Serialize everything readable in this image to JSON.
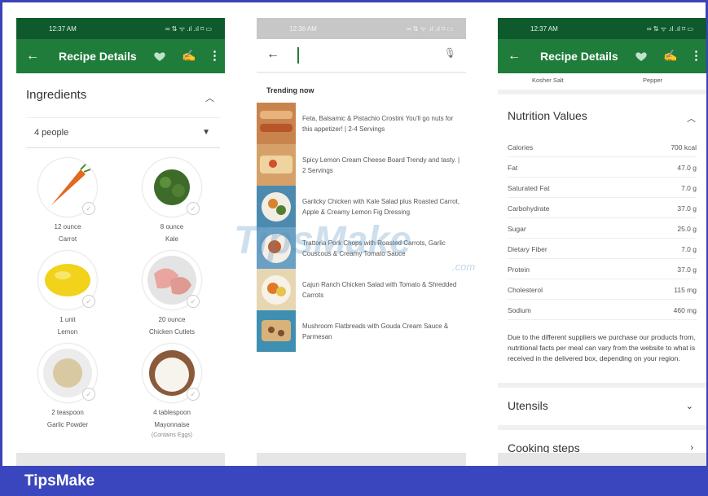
{
  "brand": {
    "footer": "TipsMake",
    "watermark": "TipsMake",
    "watermark_suffix": ".com"
  },
  "colors": {
    "frame": "#3a46bd",
    "status_dark": "#0e5a2c",
    "appbar": "#1f7c3b"
  },
  "left": {
    "status": {
      "time": "12:37 AM",
      "icons": "∞ ⇅ ᯤ .ıl .ıl ⌑ ▭"
    },
    "appbar": {
      "title": "Recipe Details",
      "back_icon": "←",
      "chef_icon": "✍",
      "more_icon": "⋮"
    },
    "ingredients": {
      "title": "Ingredients",
      "servings": "4 people",
      "items": [
        {
          "qty": "12 ounce",
          "name": "Carrot",
          "note": ""
        },
        {
          "qty": "8 ounce",
          "name": "Kale",
          "note": ""
        },
        {
          "qty": "1 unit",
          "name": "Lemon",
          "note": ""
        },
        {
          "qty": "20 ounce",
          "name": "Chicken Cutlets",
          "note": ""
        },
        {
          "qty": "2 teaspoon",
          "name": "Garlic Powder",
          "note": ""
        },
        {
          "qty": "4 tablespoon",
          "name": "Mayonnaise",
          "note": "(Contains Eggs)"
        }
      ]
    }
  },
  "mid": {
    "status": {
      "time": "12:36 AM",
      "icons": "∞ ⇅ ᯤ .ıl .ıl ⌑ ▭"
    },
    "search": {
      "back_icon": "←",
      "mic_icon": "🎙"
    },
    "trending_title": "Trending now",
    "items": [
      "Feta, Balsamic & Pistachio Crostini You'll go nuts for this appetizer! | 2-4 Servings",
      "Spicy Lemon Cream Cheese Board Trendy and tasty. | 2 Servings",
      "Garlicky Chicken with Kale Salad plus Roasted Carrot, Apple & Creamy Lemon Fig Dressing",
      "Trattoria Pork Chops with Roasted Carrots, Garlic Couscous & Creamy Tomato Sauce",
      "Cajun Ranch Chicken Salad with Tomato & Shredded Carrots",
      "Mushroom Flatbreads with Gouda Cream Sauce & Parmesan"
    ]
  },
  "right": {
    "status": {
      "time": "12:37 AM",
      "icons": "∞ ⇅ ᯤ .ıl .ıl ⌑ ▭"
    },
    "appbar": {
      "title": "Recipe Details",
      "back_icon": "←",
      "chef_icon": "✍",
      "more_icon": "⋮"
    },
    "peek": [
      "Kosher Salt",
      "Pepper"
    ],
    "nutrition": {
      "title": "Nutrition Values",
      "rows": [
        {
          "name": "Calories",
          "value": "700 kcal"
        },
        {
          "name": "Fat",
          "value": "47.0 g"
        },
        {
          "name": "Saturated Fat",
          "value": "7.0 g"
        },
        {
          "name": "Carbohydrate",
          "value": "37.0 g"
        },
        {
          "name": "Sugar",
          "value": "25.0 g"
        },
        {
          "name": "Dietary Fiber",
          "value": "7.0 g"
        },
        {
          "name": "Protein",
          "value": "37.0 g"
        },
        {
          "name": "Cholesterol",
          "value": "115 mg"
        },
        {
          "name": "Sodium",
          "value": "460 mg"
        }
      ],
      "note": "Due to the different suppliers we purchase our products from, nutritional facts per meal can vary from the website to what is received in the delivered box, depending on your region."
    },
    "sections": [
      {
        "title": "Utensils",
        "icon": "⌄"
      },
      {
        "title": "Cooking steps",
        "icon": "›"
      }
    ]
  }
}
